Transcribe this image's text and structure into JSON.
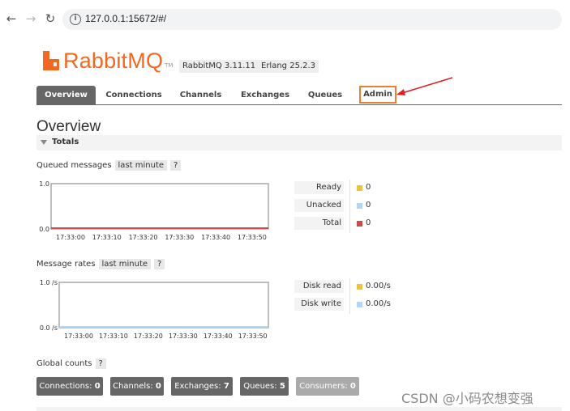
{
  "browser": {
    "url": "127.0.0.1:15672/#/",
    "back_icon": "arrow-left-icon",
    "forward_icon": "arrow-right-icon",
    "reload_icon": "reload-icon",
    "info_icon": "info-icon"
  },
  "header": {
    "logo_text": "RabbitMQ",
    "logo_tm": "TM",
    "rabbitmq_version": "RabbitMQ 3.11.11",
    "erlang_version": "Erlang 25.2.3"
  },
  "tabs": [
    {
      "label": "Overview",
      "active": true
    },
    {
      "label": "Connections",
      "active": false
    },
    {
      "label": "Channels",
      "active": false
    },
    {
      "label": "Exchanges",
      "active": false
    },
    {
      "label": "Queues",
      "active": false
    },
    {
      "label": "Admin",
      "active": false,
      "highlighted": true
    }
  ],
  "page": {
    "title": "Overview",
    "totals_label": "Totals"
  },
  "queued": {
    "label": "Queued messages",
    "option": "last minute",
    "help": "?",
    "legend": [
      {
        "name": "Ready",
        "value": "0",
        "color": "#edc240"
      },
      {
        "name": "Unacked",
        "value": "0",
        "color": "#afd8f8"
      },
      {
        "name": "Total",
        "value": "0",
        "color": "#cb4b4b"
      }
    ]
  },
  "rates": {
    "label": "Message rates",
    "option": "last minute",
    "help": "?",
    "legend": [
      {
        "name": "Disk read",
        "value": "0.00/s",
        "color": "#edc240"
      },
      {
        "name": "Disk write",
        "value": "0.00/s",
        "color": "#afd8f8"
      }
    ]
  },
  "global": {
    "label": "Global counts",
    "help": "?",
    "counts": [
      {
        "label": "Connections:",
        "value": "0",
        "disabled": false
      },
      {
        "label": "Channels:",
        "value": "0",
        "disabled": false
      },
      {
        "label": "Exchanges:",
        "value": "7",
        "disabled": false
      },
      {
        "label": "Queues:",
        "value": "5",
        "disabled": false
      },
      {
        "label": "Consumers:",
        "value": "0",
        "disabled": true
      }
    ]
  },
  "chart_data": [
    {
      "type": "line",
      "y_tick_labels": [
        "1.0",
        "0.0"
      ],
      "x": [
        "17:33:00",
        "17:33:10",
        "17:33:20",
        "17:33:30",
        "17:33:40",
        "17:33:50"
      ],
      "ylim": [
        0,
        1
      ],
      "series": [
        {
          "name": "Total",
          "values": [
            0,
            0,
            0,
            0,
            0,
            0
          ],
          "color": "#cb4b4b"
        }
      ]
    },
    {
      "type": "line",
      "y_tick_labels": [
        "1.0 /s",
        "0.0 /s"
      ],
      "x": [
        "17:33:00",
        "17:33:10",
        "17:33:20",
        "17:33:30",
        "17:33:40",
        "17:33:50"
      ],
      "ylim": [
        0,
        1
      ],
      "series": [
        {
          "name": "Disk write",
          "values": [
            0,
            0,
            0,
            0,
            0,
            0
          ],
          "color": "#afd8f8"
        }
      ]
    }
  ],
  "watermark": "CSDN @小码农想变强",
  "annotation_color": "#ee7d2d",
  "arrow_color": "#e02020"
}
